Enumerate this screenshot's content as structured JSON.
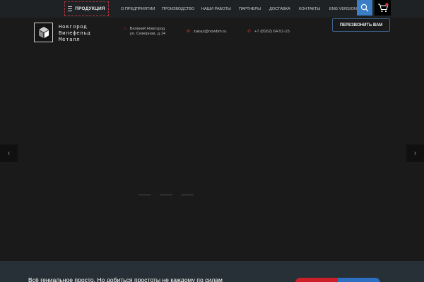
{
  "nav": {
    "products_label": "ПРОДУКЦИЯ",
    "items": [
      {
        "label": "О ПРЕДПРИЯТИИ"
      },
      {
        "label": "ПРОИЗВОДСТВО"
      },
      {
        "label": "НАШИ РАБОТЫ"
      },
      {
        "label": "ПАРТНЕРЫ"
      },
      {
        "label": "ДОСТАВКА"
      },
      {
        "label": "КОНТАКТЫ"
      },
      {
        "label": "ENG VERSION"
      }
    ],
    "search_icon": "search-icon",
    "cart_icon": "cart-icon"
  },
  "header": {
    "logo_lines": [
      "Новгород",
      "Вилефельд",
      "Металл"
    ],
    "address_line1": "Великий Новгород",
    "address_line2": "ул. Северная, д.14",
    "email": "zakaz@nowbm.ru",
    "phone": "+7 (8162) 64-51-15",
    "callback_label": "ПЕРЕЗВОНИТЬ ВАМ"
  },
  "slider": {
    "dots": 3,
    "active_dot": 0
  },
  "band": {
    "tagline": "Всё гениальное просто. Но добиться простоты не каждому по силам"
  },
  "colors": {
    "accent_red": "#d33b3b",
    "accent_blue": "#3b7ec6",
    "background": "#1a1a1a",
    "band": "#273036"
  }
}
